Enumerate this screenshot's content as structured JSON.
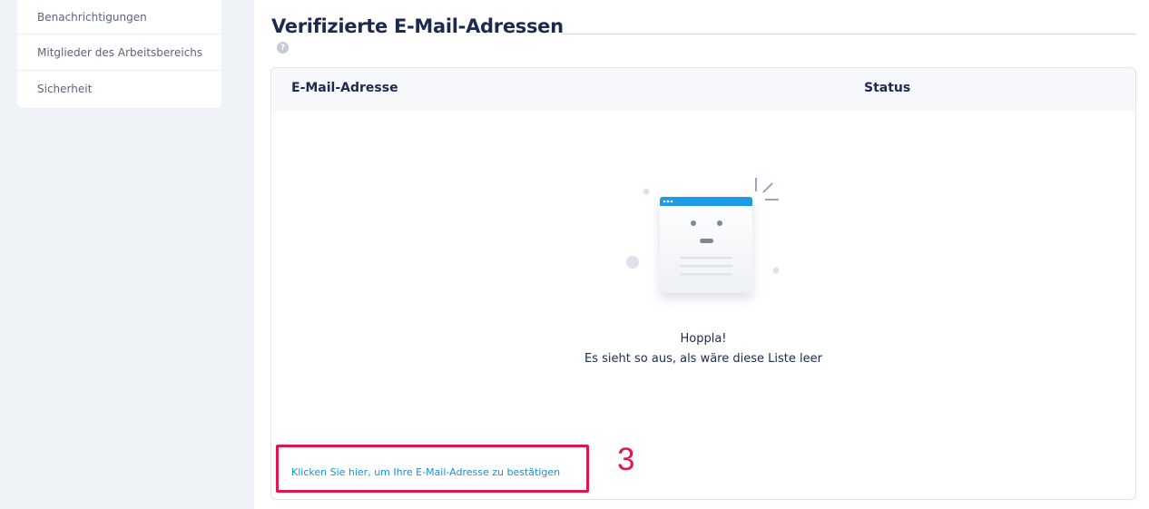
{
  "sidebar": {
    "items": [
      {
        "label": "Benachrichtigungen"
      },
      {
        "label": "Mitglieder des Arbeitsbereichs"
      },
      {
        "label": "Sicherheit"
      }
    ]
  },
  "main": {
    "title": "Verifizierte E-Mail-Adressen",
    "help_icon": "?",
    "table": {
      "columns": [
        "E-Mail-Adresse",
        "Status"
      ]
    },
    "empty_state": {
      "title": "Hoppla!",
      "description": "Es sieht so aus, als wäre diese Liste leer"
    },
    "verify_link": "Klicken Sie hier, um Ihre E-Mail-Adresse zu bestätigen"
  },
  "annotation": {
    "step_number": "3",
    "color": "#e0164d"
  },
  "colors": {
    "accent": "#1a8fd6",
    "title": "#1b2a4e",
    "sidebar_bg": "#eff2f7"
  }
}
